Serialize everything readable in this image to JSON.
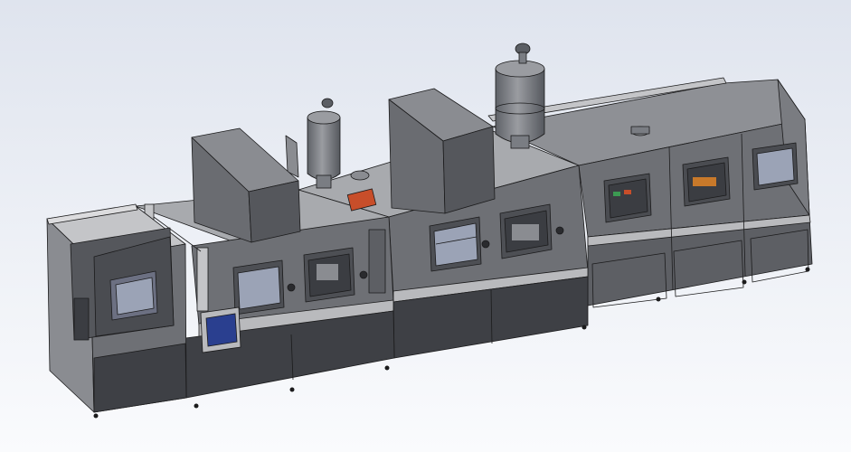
{
  "viewport": {
    "background_top": "#dfe4ee",
    "background_bottom": "#fafbfd"
  },
  "colors": {
    "panel_dark": "#55575c",
    "panel_mid": "#6e7075",
    "panel_light": "#8a8c91",
    "top_light": "#a8aaae",
    "stripe": "#c4c5c8",
    "outline": "#1b1b1c",
    "vessel": "#7a7d83",
    "screen_blue": "#2a3f8f",
    "accent_orange": "#c84e2a",
    "glass": "#9ba3b6"
  },
  "model": {
    "view": "isometric",
    "modules": [
      {
        "name": "load-lock-module",
        "type": "chamber-with-window"
      },
      {
        "name": "left-glovebox-module",
        "type": "glovebox",
        "hood": "exhaust-hood",
        "vessel": "filter-column-small"
      },
      {
        "name": "center-glovebox-module",
        "type": "glovebox",
        "hood": "exhaust-hood",
        "vessel": "filter-column-large"
      },
      {
        "name": "right-process-module",
        "type": "process-line",
        "windows": 3
      }
    ],
    "features": [
      "touch-screen-panel",
      "orange-control-plate",
      "leveling-feet"
    ]
  }
}
